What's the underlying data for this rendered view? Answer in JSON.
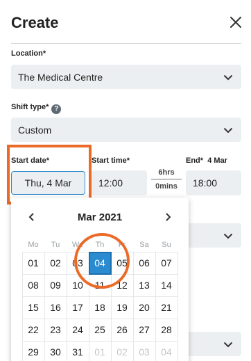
{
  "header": {
    "title": "Create"
  },
  "location": {
    "label": "Location*",
    "value": "The Medical Centre"
  },
  "shift_type": {
    "label": "Shift type*",
    "help": "?",
    "value": "Custom"
  },
  "start_date": {
    "label": "Start date*",
    "value": "Thu, 4 Mar"
  },
  "start_time": {
    "label": "Start time*",
    "value": "12:00"
  },
  "duration": {
    "hours": "6hrs",
    "mins": "0mins"
  },
  "end": {
    "label": "End*",
    "date": "4 Mar",
    "value": "18:00"
  },
  "calendar": {
    "month": "Mar 2021",
    "weekdays": [
      "Mo",
      "Tu",
      "We",
      "Th",
      "Fr",
      "Sa",
      "Su"
    ],
    "days": [
      {
        "d": "01"
      },
      {
        "d": "02"
      },
      {
        "d": "03"
      },
      {
        "d": "04",
        "selected": true
      },
      {
        "d": "05"
      },
      {
        "d": "06"
      },
      {
        "d": "07"
      },
      {
        "d": "08"
      },
      {
        "d": "09"
      },
      {
        "d": "10"
      },
      {
        "d": "11"
      },
      {
        "d": "12"
      },
      {
        "d": "13"
      },
      {
        "d": "14"
      },
      {
        "d": "15"
      },
      {
        "d": "16"
      },
      {
        "d": "17"
      },
      {
        "d": "18"
      },
      {
        "d": "19"
      },
      {
        "d": "20"
      },
      {
        "d": "21"
      },
      {
        "d": "22"
      },
      {
        "d": "23"
      },
      {
        "d": "24"
      },
      {
        "d": "25"
      },
      {
        "d": "26"
      },
      {
        "d": "27"
      },
      {
        "d": "28"
      },
      {
        "d": "29"
      },
      {
        "d": "30"
      },
      {
        "d": "31"
      },
      {
        "d": "01",
        "muted": true
      },
      {
        "d": "02",
        "muted": true
      },
      {
        "d": "03",
        "muted": true
      },
      {
        "d": "04",
        "muted": true
      }
    ]
  },
  "colors": {
    "accent": "#2a8bd0",
    "annotation": "#ec6a27",
    "field_bg": "#eceff1"
  }
}
